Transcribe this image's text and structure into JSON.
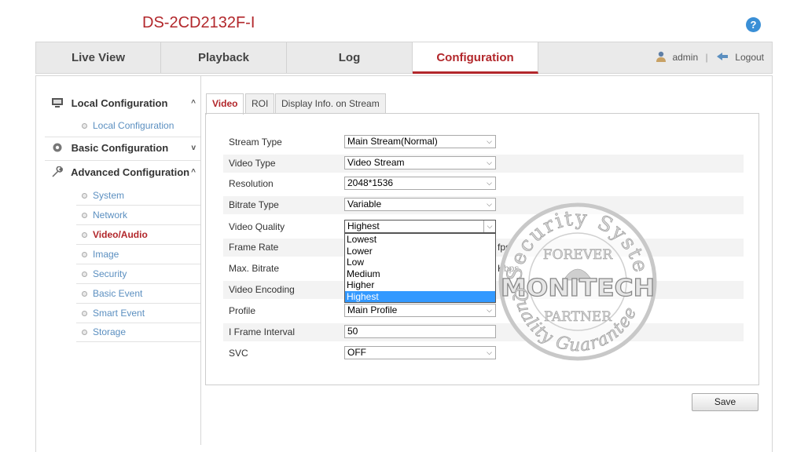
{
  "header": {
    "device_title": "DS-2CD2132F-I",
    "help_icon": "question-icon"
  },
  "nav": {
    "tabs": [
      {
        "label": "Live View"
      },
      {
        "label": "Playback"
      },
      {
        "label": "Log"
      },
      {
        "label": "Configuration"
      }
    ],
    "active_tab": "Configuration",
    "user": "admin",
    "separator": "|",
    "logout": "Logout"
  },
  "sidebar": {
    "local": {
      "label": "Local Configuration",
      "chevron": "^",
      "items": [
        "Local Configuration"
      ]
    },
    "basic": {
      "label": "Basic Configuration",
      "chevron": "v"
    },
    "advanced": {
      "label": "Advanced Configuration",
      "chevron": "^",
      "items": [
        "System",
        "Network",
        "Video/Audio",
        "Image",
        "Security",
        "Basic Event",
        "Smart Event",
        "Storage"
      ],
      "active_item": "Video/Audio"
    }
  },
  "content_tabs": [
    "Video",
    "ROI",
    "Display Info. on Stream"
  ],
  "form": {
    "stream_type": {
      "label": "Stream Type",
      "value": "Main Stream(Normal)"
    },
    "video_type": {
      "label": "Video Type",
      "value": "Video Stream"
    },
    "resolution": {
      "label": "Resolution",
      "value": "2048*1536"
    },
    "bitrate_type": {
      "label": "Bitrate Type",
      "value": "Variable"
    },
    "video_quality": {
      "label": "Video Quality",
      "value": "Highest",
      "options": [
        "Lowest",
        "Lower",
        "Low",
        "Medium",
        "Higher",
        "Highest"
      ],
      "selected": "Highest"
    },
    "frame_rate": {
      "label": "Frame Rate",
      "unit": "fps"
    },
    "max_bitrate": {
      "label": "Max. Bitrate",
      "unit": "Kbps"
    },
    "video_encoding": {
      "label": "Video Encoding"
    },
    "profile": {
      "label": "Profile",
      "value": "Main Profile"
    },
    "i_frame_interval": {
      "label": "I Frame Interval",
      "value": "50"
    },
    "svc": {
      "label": "SVC",
      "value": "OFF"
    }
  },
  "save_label": "Save",
  "watermark": {
    "top_text": "Security System",
    "forever": "FOREVER",
    "brand": "MONITECH",
    "partner": "PARTNER",
    "bottom_text": "Quality Guarantee"
  },
  "colors": {
    "accent": "#b2272b",
    "link": "#5b8fc0",
    "selection": "#3399ff"
  }
}
